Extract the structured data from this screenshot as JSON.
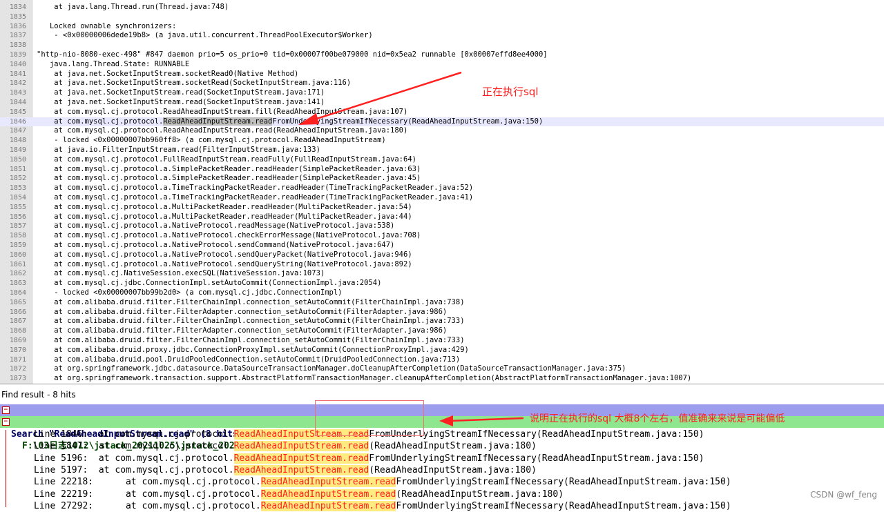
{
  "editor": {
    "current_line": "1846",
    "lines": [
      {
        "n": "1834",
        "t": "    at java.lang.Thread.run(Thread.java:748)"
      },
      {
        "n": "1835",
        "t": ""
      },
      {
        "n": "1836",
        "t": "   Locked ownable synchronizers:"
      },
      {
        "n": "1837",
        "t": "    - <0x00000006dede19b8> (a java.util.concurrent.ThreadPoolExecutor$Worker)"
      },
      {
        "n": "1838",
        "t": ""
      },
      {
        "n": "1839",
        "t": "\"http-nio-8080-exec-498\" #847 daemon prio=5 os_prio=0 tid=0x00007f00be079000 nid=0x5ea2 runnable [0x00007effd8ee4000]"
      },
      {
        "n": "1840",
        "t": "   java.lang.Thread.State: RUNNABLE"
      },
      {
        "n": "1841",
        "t": "    at java.net.SocketInputStream.socketRead0(Native Method)"
      },
      {
        "n": "1842",
        "t": "    at java.net.SocketInputStream.socketRead(SocketInputStream.java:116)"
      },
      {
        "n": "1843",
        "t": "    at java.net.SocketInputStream.read(SocketInputStream.java:171)"
      },
      {
        "n": "1844",
        "t": "    at java.net.SocketInputStream.read(SocketInputStream.java:141)"
      },
      {
        "n": "1845",
        "t": "    at com.mysql.cj.protocol.ReadAheadInputStream.fill(ReadAheadInputStream.java:107)"
      },
      {
        "n": "1846",
        "t": "    at com.mysql.cj.protocol.ReadAheadInputStream.readFromUnderlyingStreamIfNecessary(ReadAheadInputStream.java:150)"
      },
      {
        "n": "1847",
        "t": "    at com.mysql.cj.protocol.ReadAheadInputStream.read(ReadAheadInputStream.java:180)"
      },
      {
        "n": "1848",
        "t": "    - locked <0x00000007bb960ff8> (a com.mysql.cj.protocol.ReadAheadInputStream)"
      },
      {
        "n": "1849",
        "t": "    at java.io.FilterInputStream.read(FilterInputStream.java:133)"
      },
      {
        "n": "1850",
        "t": "    at com.mysql.cj.protocol.FullReadInputStream.readFully(FullReadInputStream.java:64)"
      },
      {
        "n": "1851",
        "t": "    at com.mysql.cj.protocol.a.SimplePacketReader.readHeader(SimplePacketReader.java:63)"
      },
      {
        "n": "1852",
        "t": "    at com.mysql.cj.protocol.a.SimplePacketReader.readHeader(SimplePacketReader.java:45)"
      },
      {
        "n": "1853",
        "t": "    at com.mysql.cj.protocol.a.TimeTrackingPacketReader.readHeader(TimeTrackingPacketReader.java:52)"
      },
      {
        "n": "1854",
        "t": "    at com.mysql.cj.protocol.a.TimeTrackingPacketReader.readHeader(TimeTrackingPacketReader.java:41)"
      },
      {
        "n": "1855",
        "t": "    at com.mysql.cj.protocol.a.MultiPacketReader.readHeader(MultiPacketReader.java:54)"
      },
      {
        "n": "1856",
        "t": "    at com.mysql.cj.protocol.a.MultiPacketReader.readHeader(MultiPacketReader.java:44)"
      },
      {
        "n": "1857",
        "t": "    at com.mysql.cj.protocol.a.NativeProtocol.readMessage(NativeProtocol.java:538)"
      },
      {
        "n": "1858",
        "t": "    at com.mysql.cj.protocol.a.NativeProtocol.checkErrorMessage(NativeProtocol.java:708)"
      },
      {
        "n": "1859",
        "t": "    at com.mysql.cj.protocol.a.NativeProtocol.sendCommand(NativeProtocol.java:647)"
      },
      {
        "n": "1860",
        "t": "    at com.mysql.cj.protocol.a.NativeProtocol.sendQueryPacket(NativeProtocol.java:946)"
      },
      {
        "n": "1861",
        "t": "    at com.mysql.cj.protocol.a.NativeProtocol.sendQueryString(NativeProtocol.java:892)"
      },
      {
        "n": "1862",
        "t": "    at com.mysql.cj.NativeSession.execSQL(NativeSession.java:1073)"
      },
      {
        "n": "1863",
        "t": "    at com.mysql.cj.jdbc.ConnectionImpl.setAutoCommit(ConnectionImpl.java:2054)"
      },
      {
        "n": "1864",
        "t": "    - locked <0x00000007bb99b2d0> (a com.mysql.cj.jdbc.ConnectionImpl)"
      },
      {
        "n": "1865",
        "t": "    at com.alibaba.druid.filter.FilterChainImpl.connection_setAutoCommit(FilterChainImpl.java:738)"
      },
      {
        "n": "1866",
        "t": "    at com.alibaba.druid.filter.FilterAdapter.connection_setAutoCommit(FilterAdapter.java:986)"
      },
      {
        "n": "1867",
        "t": "    at com.alibaba.druid.filter.FilterChainImpl.connection_setAutoCommit(FilterChainImpl.java:733)"
      },
      {
        "n": "1868",
        "t": "    at com.alibaba.druid.filter.FilterAdapter.connection_setAutoCommit(FilterAdapter.java:986)"
      },
      {
        "n": "1869",
        "t": "    at com.alibaba.druid.filter.FilterChainImpl.connection_setAutoCommit(FilterChainImpl.java:733)"
      },
      {
        "n": "1870",
        "t": "    at com.alibaba.druid.proxy.jdbc.ConnectionProxyImpl.setAutoCommit(ConnectionProxyImpl.java:429)"
      },
      {
        "n": "1871",
        "t": "    at com.alibaba.druid.pool.DruidPooledConnection.setAutoCommit(DruidPooledConnection.java:713)"
      },
      {
        "n": "1872",
        "t": "    at org.springframework.jdbc.datasource.DataSourceTransactionManager.doCleanupAfterCompletion(DataSourceTransactionManager.java:375)"
      },
      {
        "n": "1873",
        "t": "    at org.springframework.transaction.support.AbstractPlatformTransactionManager.cleanupAfterCompletion(AbstractPlatformTransactionManager.java:1007)"
      }
    ]
  },
  "annotations": {
    "running_sql": "正在执行sql",
    "count_note": "说明正在执行的sql 大概8个左右，值准确来来说是可能偏低"
  },
  "find": {
    "title": "Find result - 8 hits",
    "search_line": "Search \"ReadAheadInputStream.read\" (8 hits in 1 file)",
    "file_line": "F:\\03日志1012\\jstack_20211025\\jstack_20211025161901.log (8 hits)",
    "hits": [
      {
        "pre": "Line 1846:  at com.mysql.cj.protocol.",
        "match": "ReadAheadInputStream.read",
        "post": "FromUnderlyingStreamIfNecessary(ReadAheadInputStream.java:150)"
      },
      {
        "pre": "Line 1847:  at com.mysql.cj.protocol.",
        "match": "ReadAheadInputStream.read",
        "post": "(ReadAheadInputStream.java:180)"
      },
      {
        "pre": "Line 5196:  at com.mysql.cj.protocol.",
        "match": "ReadAheadInputStream.read",
        "post": "FromUnderlyingStreamIfNecessary(ReadAheadInputStream.java:150)"
      },
      {
        "pre": "Line 5197:  at com.mysql.cj.protocol.",
        "match": "ReadAheadInputStream.read",
        "post": "(ReadAheadInputStream.java:180)"
      },
      {
        "pre": "Line 22218:      at com.mysql.cj.protocol.",
        "match": "ReadAheadInputStream.read",
        "post": "FromUnderlyingStreamIfNecessary(ReadAheadInputStream.java:150)"
      },
      {
        "pre": "Line 22219:      at com.mysql.cj.protocol.",
        "match": "ReadAheadInputStream.read",
        "post": "(ReadAheadInputStream.java:180)"
      },
      {
        "pre": "Line 27292:      at com.mysql.cj.protocol.",
        "match": "ReadAheadInputStream.read",
        "post": "FromUnderlyingStreamIfNecessary(ReadAheadInputStream.java:150)"
      }
    ]
  },
  "watermark": "CSDN @wf_feng",
  "colors": {
    "annotation_red": "#ff2020",
    "search_bar": "#9d9dee",
    "file_bar": "#8ee68e",
    "match_bg": "#ffeb80"
  }
}
